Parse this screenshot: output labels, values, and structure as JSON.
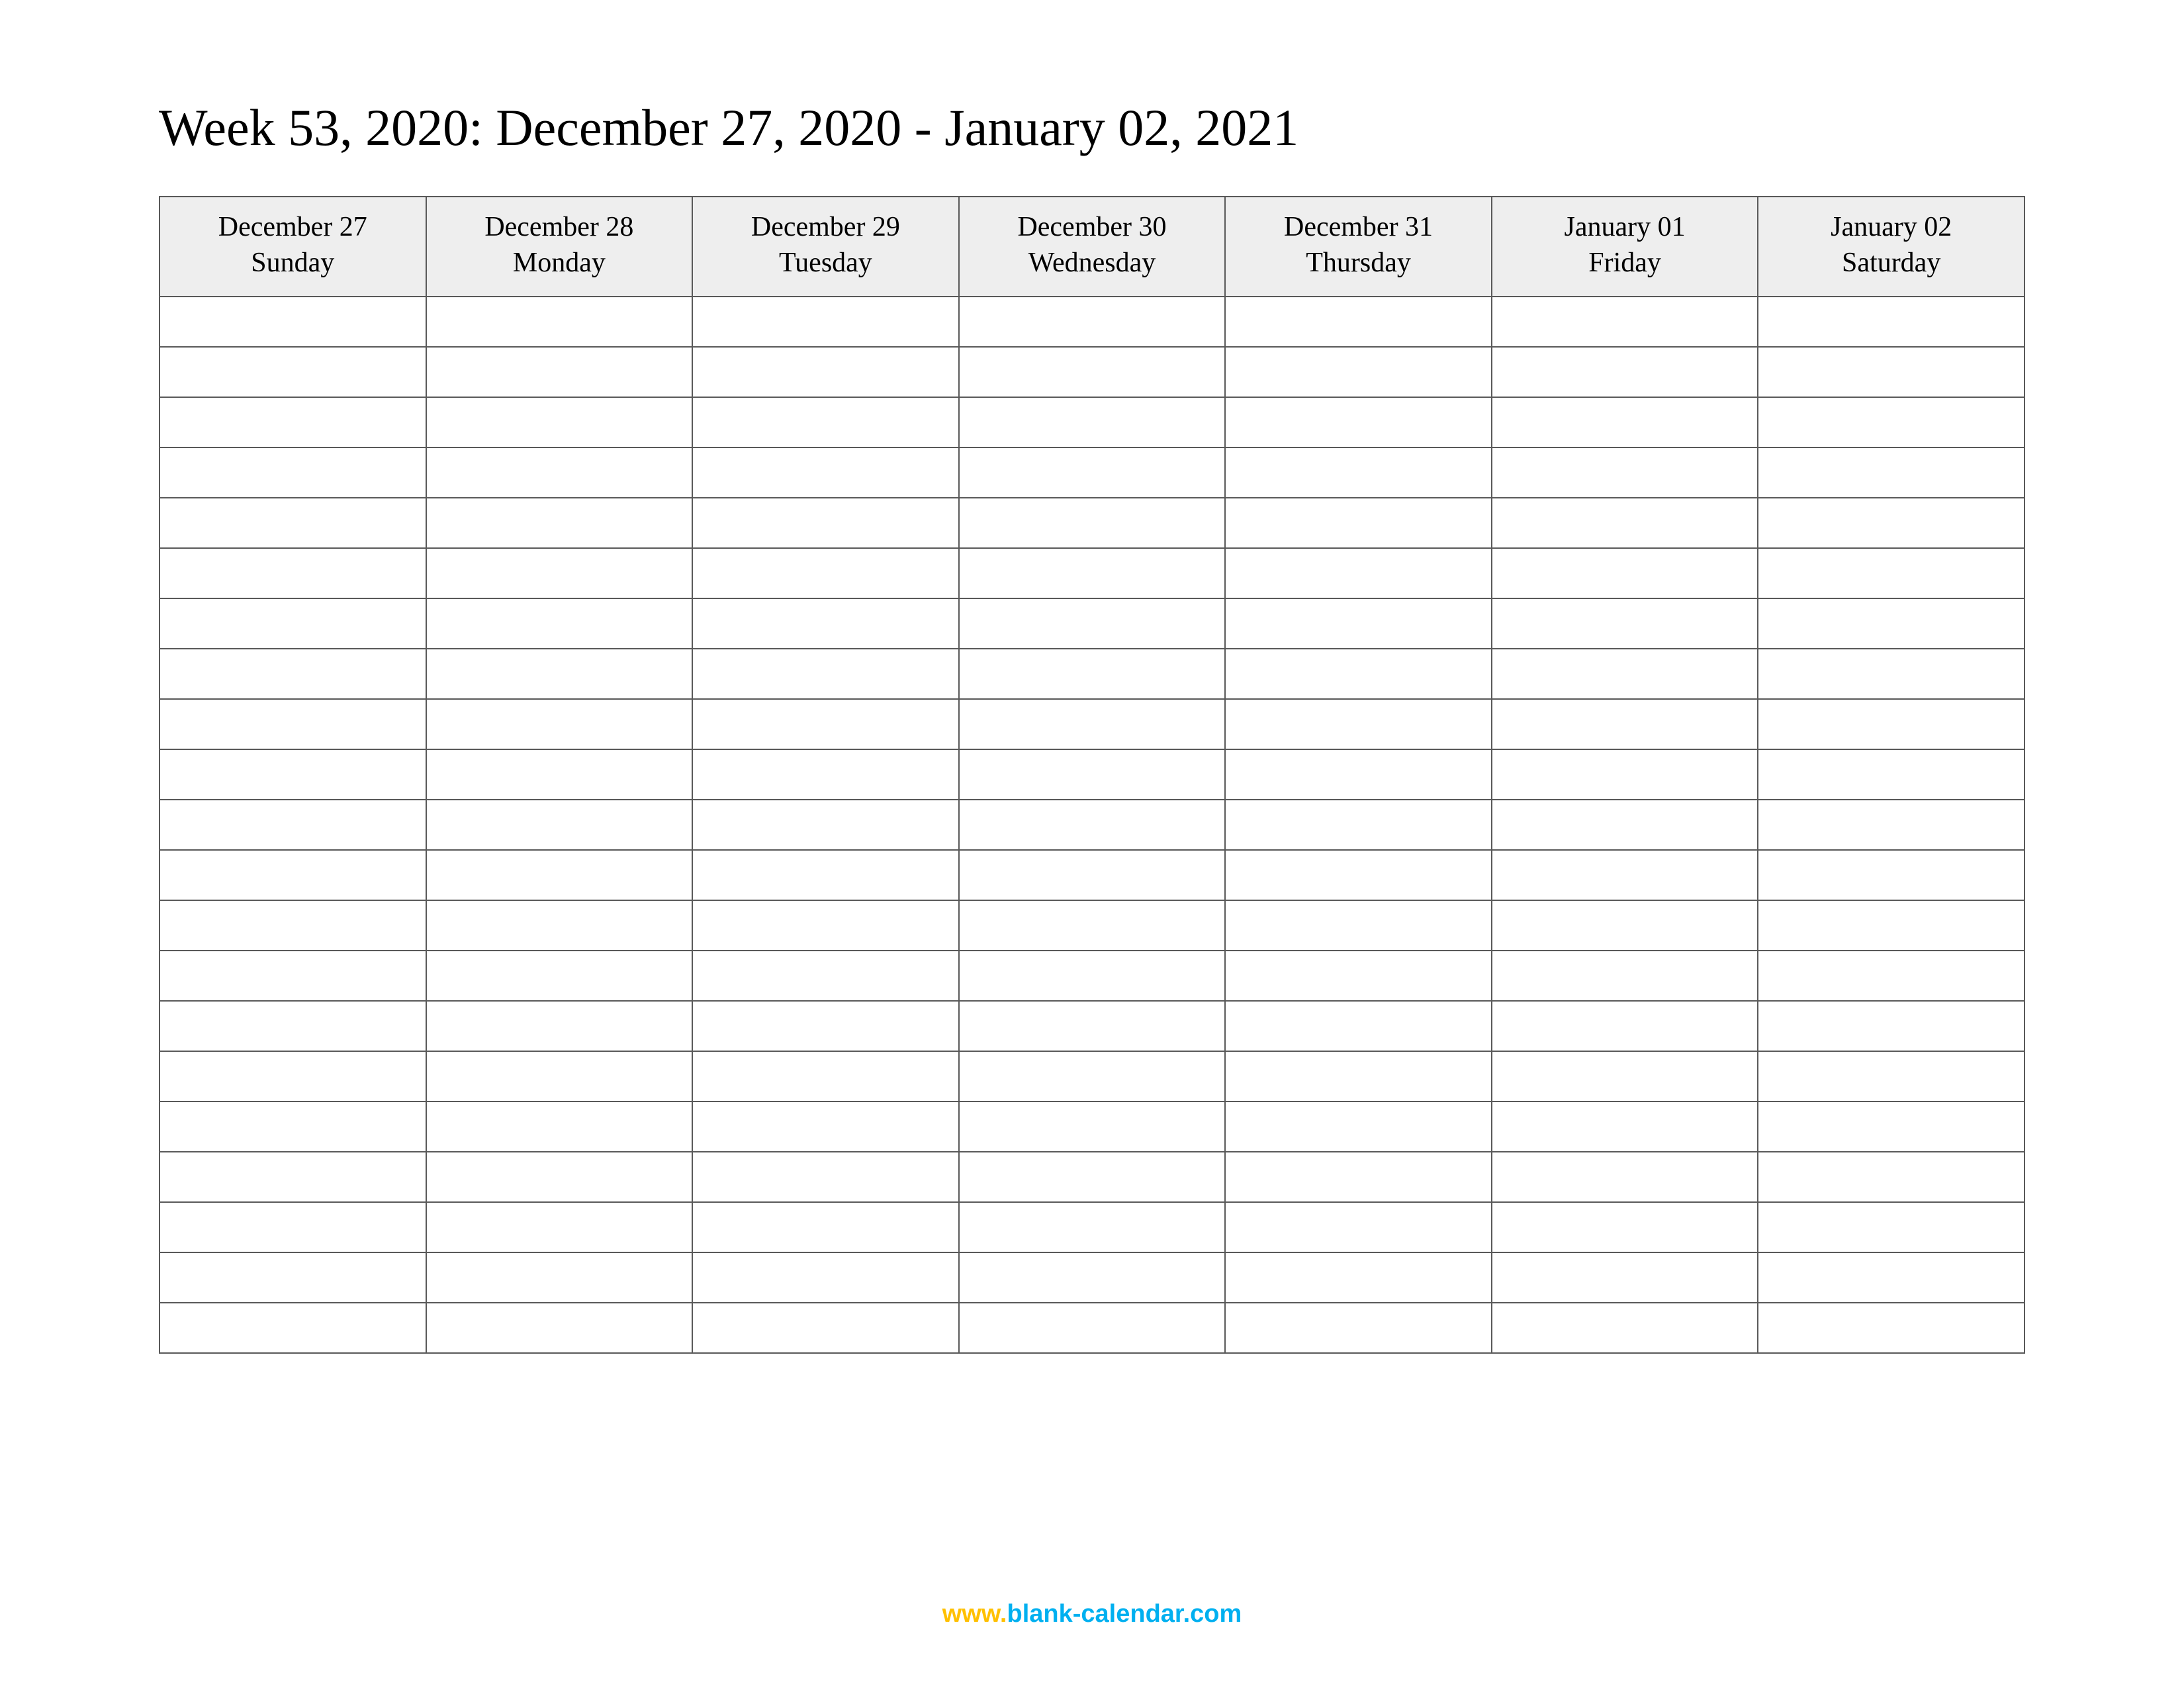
{
  "title": "Week 53, 2020: December 27, 2020 - January 02, 2021",
  "columns": [
    {
      "date": "December 27",
      "day": "Sunday"
    },
    {
      "date": "December 28",
      "day": "Monday"
    },
    {
      "date": "December 29",
      "day": "Tuesday"
    },
    {
      "date": "December 30",
      "day": "Wednesday"
    },
    {
      "date": "December 31",
      "day": "Thursday"
    },
    {
      "date": "January 01",
      "day": "Friday"
    },
    {
      "date": "January 02",
      "day": "Saturday"
    }
  ],
  "blank_row_count": 21,
  "footer": {
    "part_a": "www.",
    "part_b": "blank-calendar.com"
  }
}
